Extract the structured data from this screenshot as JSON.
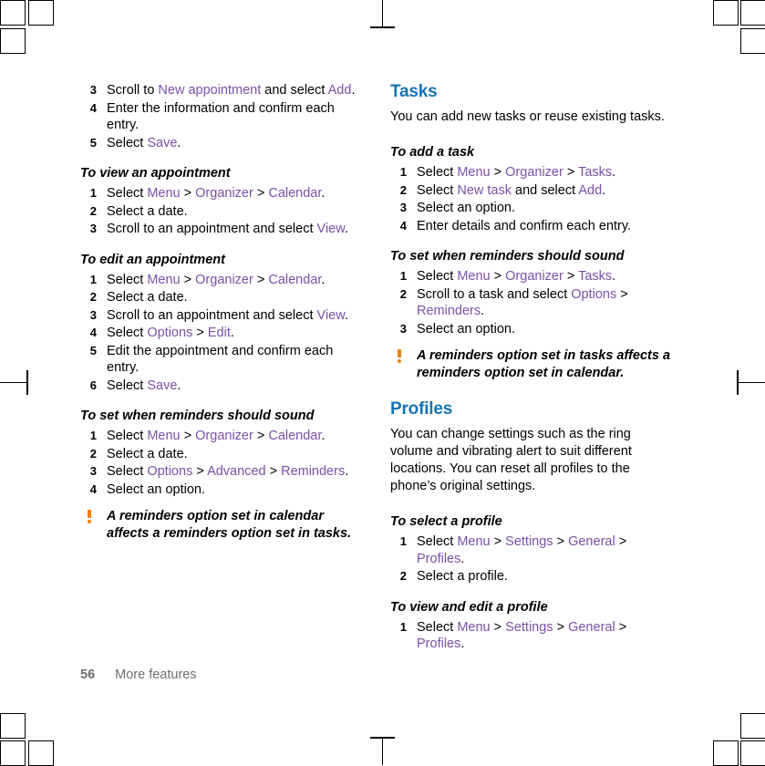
{
  "page": {
    "number": "56",
    "footer_label": "More features"
  },
  "left_column": {
    "continued_steps": [
      {
        "num": "3",
        "parts": [
          {
            "t": "Scroll to ",
            "s": "plain"
          },
          {
            "t": "New appointment",
            "s": "ui"
          },
          {
            "t": " and select ",
            "s": "plain"
          },
          {
            "t": "Add",
            "s": "ui"
          },
          {
            "t": ".",
            "s": "plain"
          }
        ]
      },
      {
        "num": "4",
        "parts": [
          {
            "t": "Enter the information and confirm each entry.",
            "s": "plain"
          }
        ]
      },
      {
        "num": "5",
        "parts": [
          {
            "t": "Select ",
            "s": "plain"
          },
          {
            "t": "Save",
            "s": "ui"
          },
          {
            "t": ".",
            "s": "plain"
          }
        ]
      }
    ],
    "sections": [
      {
        "heading": "To view an appointment",
        "steps": [
          {
            "num": "1",
            "parts": [
              {
                "t": "Select ",
                "s": "plain"
              },
              {
                "t": "Menu",
                "s": "ui"
              },
              {
                "t": " > ",
                "s": "plain"
              },
              {
                "t": "Organizer",
                "s": "ui"
              },
              {
                "t": " > ",
                "s": "plain"
              },
              {
                "t": "Calendar",
                "s": "ui"
              },
              {
                "t": ".",
                "s": "plain"
              }
            ]
          },
          {
            "num": "2",
            "parts": [
              {
                "t": "Select a date.",
                "s": "plain"
              }
            ]
          },
          {
            "num": "3",
            "parts": [
              {
                "t": "Scroll to an appointment and select ",
                "s": "plain"
              },
              {
                "t": "View",
                "s": "ui"
              },
              {
                "t": ".",
                "s": "plain"
              }
            ]
          }
        ]
      },
      {
        "heading": "To edit an appointment",
        "steps": [
          {
            "num": "1",
            "parts": [
              {
                "t": "Select ",
                "s": "plain"
              },
              {
                "t": "Menu",
                "s": "ui"
              },
              {
                "t": " > ",
                "s": "plain"
              },
              {
                "t": "Organizer",
                "s": "ui"
              },
              {
                "t": " > ",
                "s": "plain"
              },
              {
                "t": "Calendar",
                "s": "ui"
              },
              {
                "t": ".",
                "s": "plain"
              }
            ]
          },
          {
            "num": "2",
            "parts": [
              {
                "t": "Select a date.",
                "s": "plain"
              }
            ]
          },
          {
            "num": "3",
            "parts": [
              {
                "t": "Scroll to an appointment and select ",
                "s": "plain"
              },
              {
                "t": "View",
                "s": "ui"
              },
              {
                "t": ".",
                "s": "plain"
              }
            ]
          },
          {
            "num": "4",
            "parts": [
              {
                "t": "Select ",
                "s": "plain"
              },
              {
                "t": "Options",
                "s": "ui"
              },
              {
                "t": " > ",
                "s": "plain"
              },
              {
                "t": "Edit",
                "s": "ui"
              },
              {
                "t": ".",
                "s": "plain"
              }
            ]
          },
          {
            "num": "5",
            "parts": [
              {
                "t": "Edit the appointment and confirm each entry.",
                "s": "plain"
              }
            ]
          },
          {
            "num": "6",
            "parts": [
              {
                "t": "Select ",
                "s": "plain"
              },
              {
                "t": "Save",
                "s": "ui"
              },
              {
                "t": ".",
                "s": "plain"
              }
            ]
          }
        ]
      },
      {
        "heading": "To set when reminders should sound",
        "steps": [
          {
            "num": "1",
            "parts": [
              {
                "t": "Select ",
                "s": "plain"
              },
              {
                "t": "Menu",
                "s": "ui"
              },
              {
                "t": " > ",
                "s": "plain"
              },
              {
                "t": "Organizer",
                "s": "ui"
              },
              {
                "t": " > ",
                "s": "plain"
              },
              {
                "t": "Calendar",
                "s": "ui"
              },
              {
                "t": ".",
                "s": "plain"
              }
            ]
          },
          {
            "num": "2",
            "parts": [
              {
                "t": "Select a date.",
                "s": "plain"
              }
            ]
          },
          {
            "num": "3",
            "parts": [
              {
                "t": "Select ",
                "s": "plain"
              },
              {
                "t": "Options",
                "s": "ui"
              },
              {
                "t": " > ",
                "s": "plain"
              },
              {
                "t": "Advanced",
                "s": "ui"
              },
              {
                "t": " > ",
                "s": "plain"
              },
              {
                "t": "Reminders",
                "s": "ui"
              },
              {
                "t": ".",
                "s": "plain"
              }
            ]
          },
          {
            "num": "4",
            "parts": [
              {
                "t": "Select an option.",
                "s": "plain"
              }
            ]
          }
        ]
      }
    ],
    "note": "A reminders option set in calendar affects a reminders option set in tasks."
  },
  "right_column": {
    "tasks": {
      "heading": "Tasks",
      "intro": "You can add new tasks or reuse existing tasks.",
      "sections": [
        {
          "heading": "To add a task",
          "steps": [
            {
              "num": "1",
              "parts": [
                {
                  "t": "Select ",
                  "s": "plain"
                },
                {
                  "t": "Menu",
                  "s": "ui"
                },
                {
                  "t": " > ",
                  "s": "plain"
                },
                {
                  "t": "Organizer",
                  "s": "ui"
                },
                {
                  "t": " > ",
                  "s": "plain"
                },
                {
                  "t": "Tasks",
                  "s": "ui"
                },
                {
                  "t": ".",
                  "s": "plain"
                }
              ]
            },
            {
              "num": "2",
              "parts": [
                {
                  "t": "Select ",
                  "s": "plain"
                },
                {
                  "t": "New task",
                  "s": "ui"
                },
                {
                  "t": " and select ",
                  "s": "plain"
                },
                {
                  "t": "Add",
                  "s": "ui"
                },
                {
                  "t": ".",
                  "s": "plain"
                }
              ]
            },
            {
              "num": "3",
              "parts": [
                {
                  "t": "Select an option.",
                  "s": "plain"
                }
              ]
            },
            {
              "num": "4",
              "parts": [
                {
                  "t": "Enter details and confirm each entry.",
                  "s": "plain"
                }
              ]
            }
          ]
        },
        {
          "heading": "To set when reminders should sound",
          "steps": [
            {
              "num": "1",
              "parts": [
                {
                  "t": "Select ",
                  "s": "plain"
                },
                {
                  "t": "Menu",
                  "s": "ui"
                },
                {
                  "t": " > ",
                  "s": "plain"
                },
                {
                  "t": "Organizer",
                  "s": "ui"
                },
                {
                  "t": " > ",
                  "s": "plain"
                },
                {
                  "t": "Tasks",
                  "s": "ui"
                },
                {
                  "t": ".",
                  "s": "plain"
                }
              ]
            },
            {
              "num": "2",
              "parts": [
                {
                  "t": "Scroll to a task and select ",
                  "s": "plain"
                },
                {
                  "t": "Options",
                  "s": "ui"
                },
                {
                  "t": " > ",
                  "s": "plain"
                },
                {
                  "t": "Reminders",
                  "s": "ui"
                },
                {
                  "t": ".",
                  "s": "plain"
                }
              ]
            },
            {
              "num": "3",
              "parts": [
                {
                  "t": "Select an option.",
                  "s": "plain"
                }
              ]
            }
          ]
        }
      ],
      "note": "A reminders option set in tasks affects a reminders option set in calendar."
    },
    "profiles": {
      "heading": "Profiles",
      "intro": "You can change settings such as the ring volume and vibrating alert to suit different locations. You can reset all profiles to the phone’s original settings.",
      "sections": [
        {
          "heading": "To select a profile",
          "steps": [
            {
              "num": "1",
              "parts": [
                {
                  "t": "Select ",
                  "s": "plain"
                },
                {
                  "t": "Menu",
                  "s": "ui"
                },
                {
                  "t": " > ",
                  "s": "plain"
                },
                {
                  "t": "Settings",
                  "s": "ui"
                },
                {
                  "t": " > ",
                  "s": "plain"
                },
                {
                  "t": "General",
                  "s": "ui"
                },
                {
                  "t": " > ",
                  "s": "plain"
                },
                {
                  "t": "Profiles",
                  "s": "ui"
                },
                {
                  "t": ".",
                  "s": "plain"
                }
              ]
            },
            {
              "num": "2",
              "parts": [
                {
                  "t": "Select a profile.",
                  "s": "plain"
                }
              ]
            }
          ]
        },
        {
          "heading": "To view and edit a profile",
          "steps": [
            {
              "num": "1",
              "parts": [
                {
                  "t": "Select ",
                  "s": "plain"
                },
                {
                  "t": "Menu",
                  "s": "ui"
                },
                {
                  "t": " > ",
                  "s": "plain"
                },
                {
                  "t": "Settings",
                  "s": "ui"
                },
                {
                  "t": " > ",
                  "s": "plain"
                },
                {
                  "t": "General",
                  "s": "ui"
                },
                {
                  "t": " > ",
                  "s": "plain"
                },
                {
                  "t": "Profiles",
                  "s": "ui"
                },
                {
                  "t": ".",
                  "s": "plain"
                }
              ]
            }
          ]
        }
      ]
    }
  },
  "colors": {
    "heading_blue": "#1573b4",
    "ui_purple": "#7b4fa8",
    "note_orange": "#f07d00",
    "footer_gray": "#6e6e6e"
  }
}
